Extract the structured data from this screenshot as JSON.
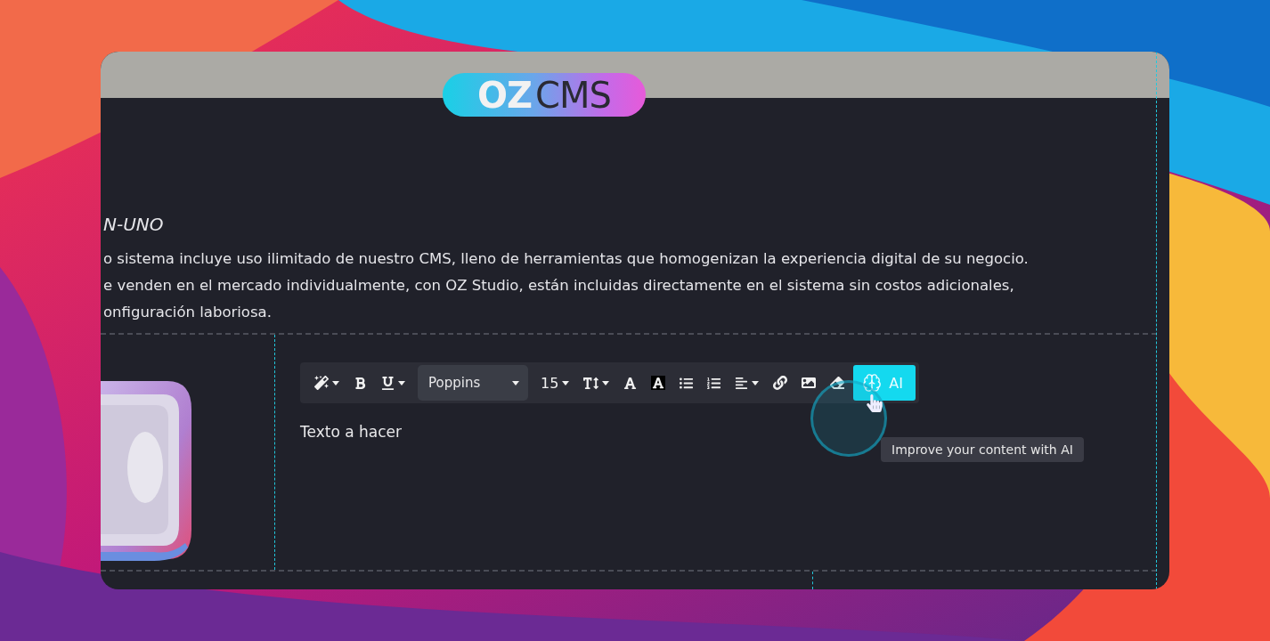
{
  "logo": {
    "left": "OZ",
    "right": "CMS"
  },
  "intro": {
    "heading": "N-UNO",
    "lines": [
      "o sistema incluye uso ilimitado de nuestro CMS, lleno de herramientas que homogenizan la experiencia digital de su negocio.",
      "e venden en el mercado individualmente, con OZ Studio, están incluidas directamente en el sistema sin costos adicionales,",
      "onfiguración laboriosa."
    ]
  },
  "toolbar": {
    "font": "Poppins",
    "size": "15",
    "ai_button": {
      "label": "AI",
      "hovered": true
    },
    "tooltip": "Improve your content with AI"
  },
  "editor": {
    "text": "Texto a hacer"
  }
}
